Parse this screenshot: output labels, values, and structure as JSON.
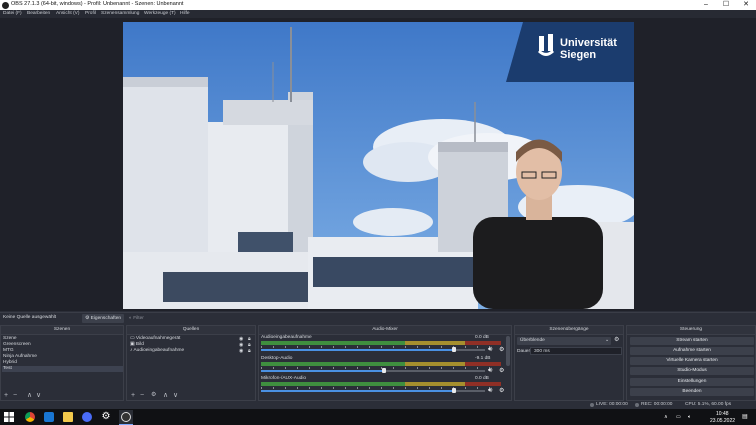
{
  "window": {
    "title": "OBS 27.1.3 (64-bit, windows) - Profil: Unbenannt - Szenen: Unbenannt"
  },
  "menu": [
    "Datei (F)",
    "Bearbeiten",
    "Ansicht (V)",
    "Profil",
    "Szenensammlung",
    "Werkzeuge (T)",
    "Hilfe"
  ],
  "preview": {
    "logo_line1": "Universität",
    "logo_line2": "Siegen"
  },
  "source_bar": {
    "status": "Keine Quelle ausgewählt",
    "properties": "Eigenschaften",
    "filters": "Filter"
  },
  "scenes": {
    "title": "Szenen",
    "items": [
      "Szene",
      "Greenscreen",
      "MTG",
      "Ninja Aufnahme",
      "Hybrid",
      "Test"
    ],
    "selected": 5
  },
  "sources": {
    "title": "Quellen",
    "items": [
      "Videoaufnahmegerät",
      "Bild",
      "Audioeingabeaufnahme"
    ]
  },
  "mixer": {
    "title": "Audio-Mixer",
    "channels": [
      {
        "name": "Audioeingabeaufnahme",
        "db": "0.0 dB",
        "level": 0.86
      },
      {
        "name": "Desktop-Audio",
        "db": "-9.1 dB",
        "level": 0.55
      },
      {
        "name": "Mikrofon-/AUX-Audio",
        "db": "0.0 dB",
        "level": 0.86
      }
    ]
  },
  "transitions": {
    "title": "Szenenübergänge",
    "type": "Überblende",
    "duration_label": "Dauer",
    "duration_value": "300 ms"
  },
  "controls": {
    "title": "Steuerung",
    "buttons": [
      "Stream starten",
      "Aufnahme starten",
      "Virtuelle Kamera starten",
      "Studio-Modus",
      "Einstellungen",
      "Beenden"
    ]
  },
  "status": {
    "live": "LIVE: 00:00:00",
    "rec": "REC: 00:00:00",
    "cpu": "CPU: 5.1%, 60.00 fps"
  },
  "taskbar": {
    "time": "10:48",
    "date": "23.05.2022"
  },
  "colors": {
    "accent": "#1b3c6e",
    "panel": "#2b2e38",
    "meter_green": "#4caf50",
    "meter_yellow": "#c9b13b",
    "meter_red": "#c0392b"
  }
}
